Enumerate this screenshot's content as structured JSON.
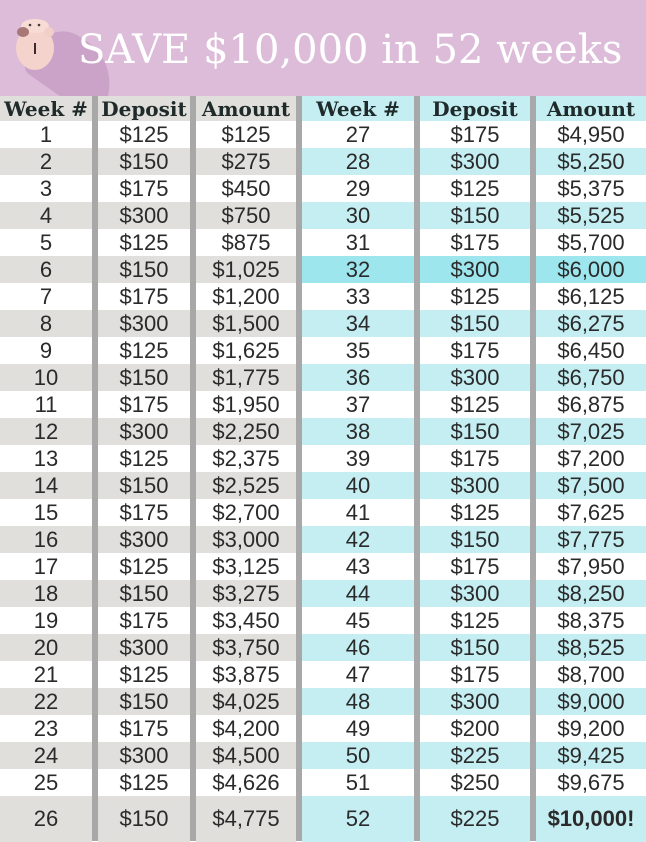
{
  "title": "SAVE $10,000 in 52 weeks",
  "icon": "piggy-bank-icon",
  "colors": {
    "banner": "#dcbcd9",
    "left_header": "#e0dfdb",
    "left_stripe": "#e0dfdb",
    "right_header": "#c5eef2",
    "right_stripe": "#c5eef2",
    "right_highlight": "#9ee6ee",
    "divider": "#a8a8a8"
  },
  "headers": [
    "Week #",
    "Deposit",
    "Amount",
    "Week #",
    "Deposit",
    "Amount"
  ],
  "left_rows": [
    {
      "week": "1",
      "deposit": "$125",
      "amount": "$125"
    },
    {
      "week": "2",
      "deposit": "$150",
      "amount": "$275"
    },
    {
      "week": "3",
      "deposit": "$175",
      "amount": "$450"
    },
    {
      "week": "4",
      "deposit": "$300",
      "amount": "$750"
    },
    {
      "week": "5",
      "deposit": "$125",
      "amount": "$875"
    },
    {
      "week": "6",
      "deposit": "$150",
      "amount": "$1,025"
    },
    {
      "week": "7",
      "deposit": "$175",
      "amount": "$1,200"
    },
    {
      "week": "8",
      "deposit": "$300",
      "amount": "$1,500"
    },
    {
      "week": "9",
      "deposit": "$125",
      "amount": "$1,625"
    },
    {
      "week": "10",
      "deposit": "$150",
      "amount": "$1,775"
    },
    {
      "week": "11",
      "deposit": "$175",
      "amount": "$1,950"
    },
    {
      "week": "12",
      "deposit": "$300",
      "amount": "$2,250"
    },
    {
      "week": "13",
      "deposit": "$125",
      "amount": "$2,375"
    },
    {
      "week": "14",
      "deposit": "$150",
      "amount": "$2,525"
    },
    {
      "week": "15",
      "deposit": "$175",
      "amount": "$2,700"
    },
    {
      "week": "16",
      "deposit": "$300",
      "amount": "$3,000"
    },
    {
      "week": "17",
      "deposit": "$125",
      "amount": "$3,125"
    },
    {
      "week": "18",
      "deposit": "$150",
      "amount": "$3,275"
    },
    {
      "week": "19",
      "deposit": "$175",
      "amount": "$3,450"
    },
    {
      "week": "20",
      "deposit": "$300",
      "amount": "$3,750"
    },
    {
      "week": "21",
      "deposit": "$125",
      "amount": "$3,875"
    },
    {
      "week": "22",
      "deposit": "$150",
      "amount": "$4,025"
    },
    {
      "week": "23",
      "deposit": "$175",
      "amount": "$4,200"
    },
    {
      "week": "24",
      "deposit": "$300",
      "amount": "$4,500"
    },
    {
      "week": "25",
      "deposit": "$125",
      "amount": "$4,626"
    },
    {
      "week": "26",
      "deposit": "$150",
      "amount": "$4,775"
    }
  ],
  "right_rows": [
    {
      "week": "27",
      "deposit": "$175",
      "amount": "$4,950"
    },
    {
      "week": "28",
      "deposit": "$300",
      "amount": "$5,250"
    },
    {
      "week": "29",
      "deposit": "$125",
      "amount": "$5,375"
    },
    {
      "week": "30",
      "deposit": "$150",
      "amount": "$5,525"
    },
    {
      "week": "31",
      "deposit": "$175",
      "amount": "$5,700"
    },
    {
      "week": "32",
      "deposit": "$300",
      "amount": "$6,000",
      "highlight": true
    },
    {
      "week": "33",
      "deposit": "$125",
      "amount": "$6,125"
    },
    {
      "week": "34",
      "deposit": "$150",
      "amount": "$6,275"
    },
    {
      "week": "35",
      "deposit": "$175",
      "amount": "$6,450"
    },
    {
      "week": "36",
      "deposit": "$300",
      "amount": "$6,750"
    },
    {
      "week": "37",
      "deposit": "$125",
      "amount": "$6,875"
    },
    {
      "week": "38",
      "deposit": "$150",
      "amount": "$7,025"
    },
    {
      "week": "39",
      "deposit": "$175",
      "amount": "$7,200"
    },
    {
      "week": "40",
      "deposit": "$300",
      "amount": "$7,500"
    },
    {
      "week": "41",
      "deposit": "$125",
      "amount": "$7,625"
    },
    {
      "week": "42",
      "deposit": "$150",
      "amount": "$7,775"
    },
    {
      "week": "43",
      "deposit": "$175",
      "amount": "$7,950"
    },
    {
      "week": "44",
      "deposit": "$300",
      "amount": "$8,250"
    },
    {
      "week": "45",
      "deposit": "$125",
      "amount": "$8,375"
    },
    {
      "week": "46",
      "deposit": "$150",
      "amount": "$8,525"
    },
    {
      "week": "47",
      "deposit": "$175",
      "amount": "$8,700"
    },
    {
      "week": "48",
      "deposit": "$300",
      "amount": "$9,000"
    },
    {
      "week": "49",
      "deposit": "$200",
      "amount": "$9,200"
    },
    {
      "week": "50",
      "deposit": "$225",
      "amount": "$9,425"
    },
    {
      "week": "51",
      "deposit": "$250",
      "amount": "$9,675"
    },
    {
      "week": "52",
      "deposit": "$225",
      "amount": "$10,000!",
      "bold": true
    }
  ]
}
